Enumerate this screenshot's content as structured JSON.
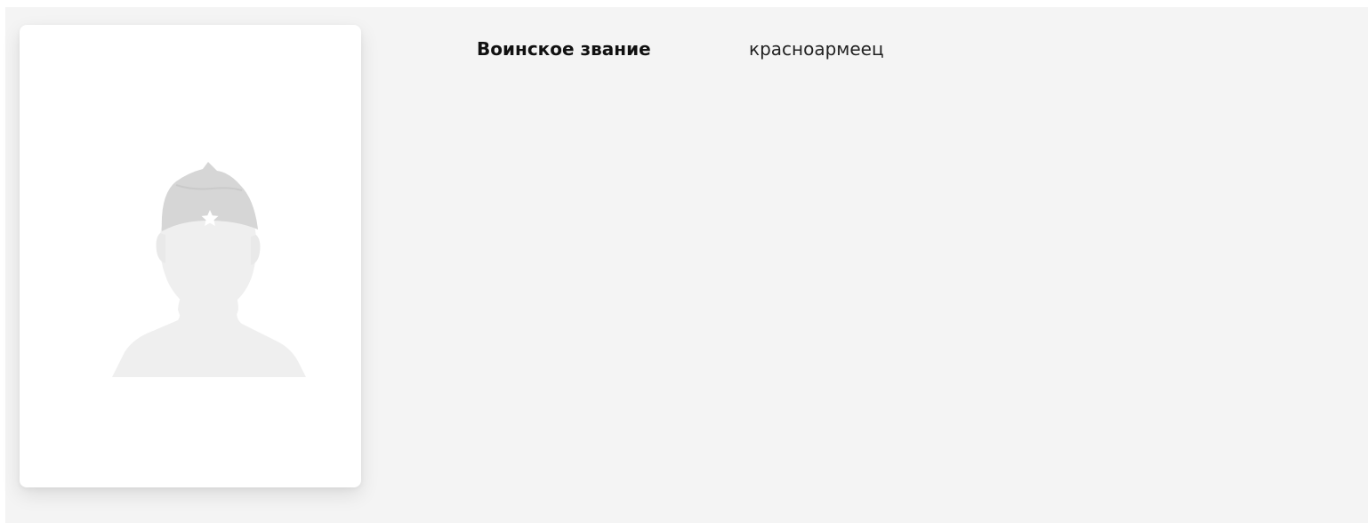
{
  "profile": {
    "photo_placeholder_icon": "soldier-silhouette-icon",
    "fields": [
      {
        "label": "Воинское звание",
        "value": "красноармеец"
      }
    ]
  },
  "colors": {
    "panel_background": "#f4f4f4",
    "card_background": "#ffffff",
    "silhouette_light": "#eeeeee",
    "silhouette_cap": "#d6d6d6",
    "star": "#ffffff"
  }
}
